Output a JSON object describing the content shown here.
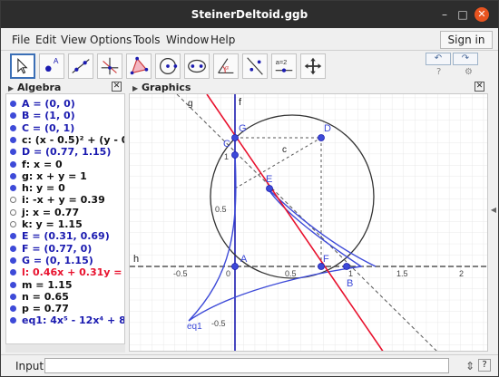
{
  "window": {
    "title": "SteinerDeltoid.ggb"
  },
  "menu": [
    "File",
    "Edit",
    "View",
    "Options",
    "Tools",
    "Window",
    "Help"
  ],
  "signin_label": "Sign in",
  "algebra_panel": {
    "title": "Algebra",
    "rows": [
      {
        "text": "A = (0, 0)",
        "color": "#1b1bb0",
        "filled": true
      },
      {
        "text": "B = (1, 0)",
        "color": "#1b1bb0",
        "filled": true
      },
      {
        "text": "C = (0, 1)",
        "color": "#1b1bb0",
        "filled": true
      },
      {
        "text": "c: (x - 0.5)² + (y - 0",
        "color": "#111111",
        "filled": true
      },
      {
        "text": "D = (0.77, 1.15)",
        "color": "#1b1bb0",
        "filled": true
      },
      {
        "text": "f: x = 0",
        "color": "#111111",
        "filled": true
      },
      {
        "text": "g: x + y = 1",
        "color": "#111111",
        "filled": true
      },
      {
        "text": "h: y = 0",
        "color": "#111111",
        "filled": true
      },
      {
        "text": "i: -x + y = 0.39",
        "color": "#111111",
        "filled": false
      },
      {
        "text": "j: x = 0.77",
        "color": "#111111",
        "filled": false
      },
      {
        "text": "k: y = 1.15",
        "color": "#111111",
        "filled": false
      },
      {
        "text": "E = (0.31, 0.69)",
        "color": "#1b1bb0",
        "filled": true
      },
      {
        "text": "F = (0.77, 0)",
        "color": "#1b1bb0",
        "filled": true
      },
      {
        "text": "G = (0, 1.15)",
        "color": "#1b1bb0",
        "filled": true
      },
      {
        "text": "l: 0.46x + 0.31y =",
        "color": "#e8112d",
        "filled": true
      },
      {
        "text": "m = 1.15",
        "color": "#111111",
        "filled": true
      },
      {
        "text": "n = 0.65",
        "color": "#111111",
        "filled": true
      },
      {
        "text": "p = 0.77",
        "color": "#111111",
        "filled": true
      },
      {
        "text": "eq1: 4x⁵ - 12x⁴ + 8",
        "color": "#1b1bb0",
        "filled": true
      }
    ]
  },
  "graphics_panel": {
    "title": "Graphics",
    "axis_labels": {
      "x": "h",
      "y": "f"
    },
    "ticks_x": [
      "-0.5",
      "0",
      "0.5",
      "1",
      "1.5",
      "2"
    ],
    "ticks_y": [
      "1",
      "0.5",
      "-0.5"
    ],
    "point_labels": [
      "A",
      "B",
      "C",
      "D",
      "E",
      "F",
      "G"
    ],
    "curve_labels": {
      "circle": "c",
      "line_g": "g",
      "deltoid": "eq1"
    }
  },
  "toolbar": {
    "tools": [
      "move-tool",
      "point-tool",
      "line-tool",
      "perpendicular-tool",
      "polygon-tool",
      "circle-tool",
      "conic-tool",
      "angle-tool",
      "reflect-tool",
      "slider-tool",
      "move-view-tool"
    ],
    "slider_label": "a=2",
    "undo_label": "↶",
    "redo_label": "↷"
  },
  "input_bar": {
    "label": "Input:",
    "placeholder": ""
  },
  "colors": {
    "point_blue": "#1b1bb0",
    "line_red": "#e8112d",
    "deltoid_blue": "#3d4ad8",
    "titlebar": "#2d2d2d",
    "close_button": "#e95420"
  }
}
